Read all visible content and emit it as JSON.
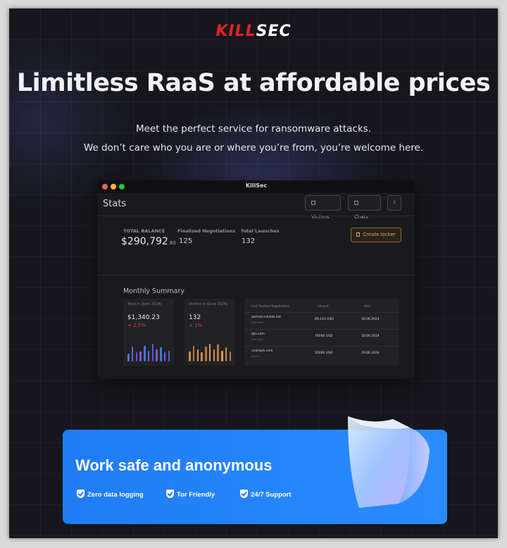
{
  "brand": {
    "logo_a": "K",
    "logo_b": "ILL",
    "logo_c": "SEC"
  },
  "hero": {
    "headline": "Limitless RaaS at affordable prices",
    "line1": "Meet the perfect service for ransomware attacks.",
    "line2": "We don’t care who you are or where you’re from, you’re welcome here."
  },
  "app": {
    "window_title": "KillSec",
    "page_title": "Stats",
    "buttons": {
      "victims": "Victims",
      "chats": "Chats",
      "help": "?"
    },
    "total_balance": {
      "label": "TOTAL BALANCE",
      "value": "$290,792",
      "cents": ".60"
    },
    "finalized": {
      "label": "Finalized Negotiations",
      "value": "125"
    },
    "launches": {
      "label": "Total Launches",
      "value": "132"
    },
    "create_locker": "Create locker",
    "monthly_summary": "Monthly Summary",
    "card_total": {
      "title": "Total in (June 2024)",
      "value": "$1,340.23",
      "delta": "+ 2.5%"
    },
    "card_victims": {
      "title": "Victims in (June 2024)",
      "value": "132",
      "delta": "+ 1%"
    },
    "table": {
      "headers": [
        "Last Finalized Negotiations",
        "amount",
        "date"
      ],
      "rows": [
        {
          "site": "women+dumb.net",
          "sub": "text build",
          "amount": "89,141 USD",
          "date": "30.06.2024"
        },
        {
          "site": "lgis.com",
          "sub": "text build",
          "amount": "76000 USD",
          "date": "30.06.2024"
        },
        {
          "site": "example.com",
          "sub": "build 3",
          "amount": "35000 USD",
          "date": "29.06.2024"
        }
      ]
    },
    "bars_total": [
      0.4,
      0.75,
      0.45,
      0.5,
      0.8,
      0.55,
      0.9,
      0.6,
      0.7,
      0.45,
      0.55
    ],
    "bars_victims": [
      0.5,
      0.8,
      0.6,
      0.45,
      0.75,
      0.9,
      0.6,
      0.85,
      0.55,
      0.7,
      0.5
    ]
  },
  "banner": {
    "title": "Work safe and anonymous",
    "features": [
      "Zero data logging",
      "Tor Friendly",
      "24/7 Support"
    ]
  },
  "colors": {
    "accent_blue": "#1f7cf5",
    "logo_red": "#e02424",
    "locker_gold": "#d9a85a"
  }
}
